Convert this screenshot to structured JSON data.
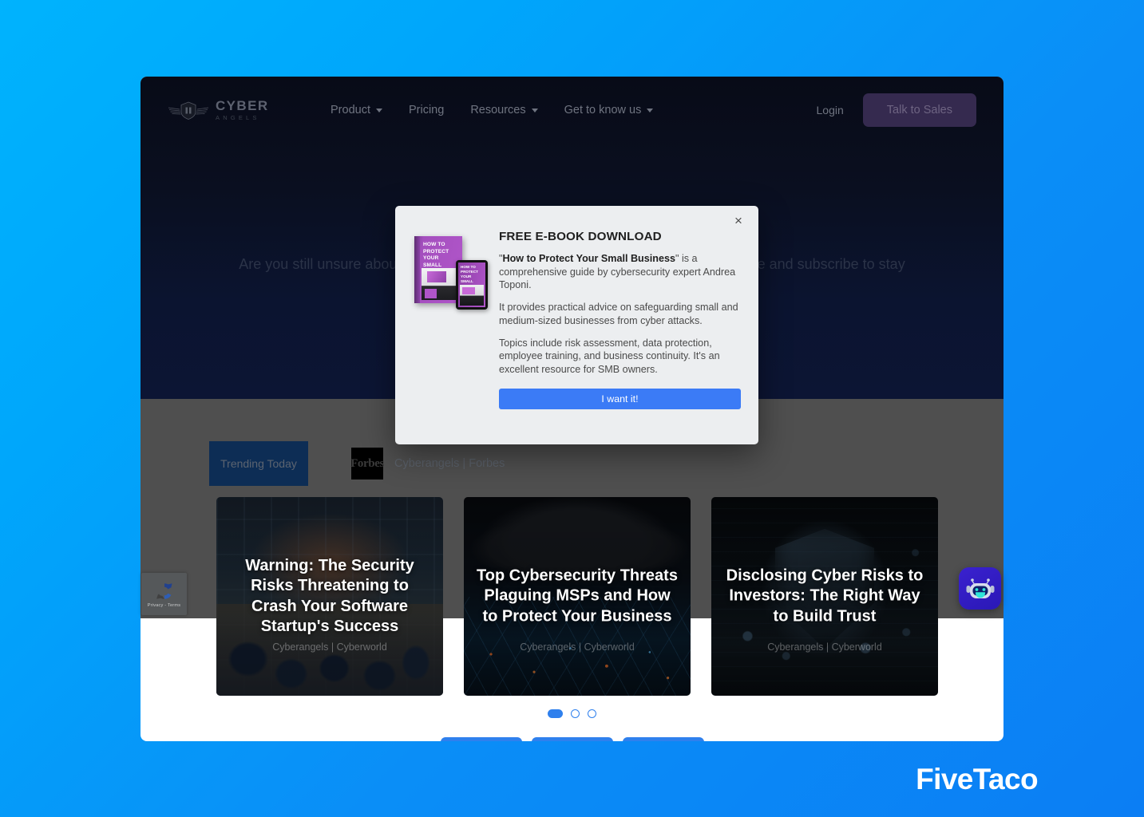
{
  "background": {
    "from": "#00b3fd",
    "to": "#0b7ef4"
  },
  "navbar": {
    "brand_name": "CYBER",
    "brand_sub": "ANGELS",
    "links": [
      {
        "label": "Product",
        "has_caret": true
      },
      {
        "label": "Pricing",
        "has_caret": false
      },
      {
        "label": "Resources",
        "has_caret": true
      },
      {
        "label": "Get to know us",
        "has_caret": true
      }
    ],
    "login_label": "Login",
    "cta_label": "Talk to Sales"
  },
  "hero": {
    "paragraph": "Are you still unsure about our services? Explore our resources below to learn more and subscribe to stay"
  },
  "trending": {
    "tab_label": "Trending Today",
    "source_logo": "Forbes",
    "source_label": "Cyberangels | Forbes",
    "cards": [
      {
        "title": "Warning: The Security Risks Threatening to Crash Your Software Startup's Success",
        "credit": "Cyberangels | Cyberworld",
        "art": "office-workspace"
      },
      {
        "title": "Top Cybersecurity Threats Plaguing MSPs and How to Protect Your Business",
        "credit": "Cyberangels | Cyberworld",
        "art": "storm-network"
      },
      {
        "title": "Disclosing Cyber Risks to Investors: The Right Way to Build Trust",
        "credit": "Cyberangels | Cyberworld",
        "art": "cracked-shield"
      }
    ],
    "dots": [
      {
        "active": true
      },
      {
        "active": false
      },
      {
        "active": false
      }
    ],
    "accent_color": "#2f80ed"
  },
  "bottom_buttons": [
    {
      "label": ""
    },
    {
      "label": ""
    },
    {
      "label": ""
    }
  ],
  "recaptcha": {
    "label": "Privacy - Terms"
  },
  "chat_widget": {
    "name": "chat-bot"
  },
  "modal": {
    "close_label": "×",
    "heading": "FREE E-BOOK DOWNLOAD",
    "paragraph1_prefix": "\"",
    "paragraph1_bold": "How to Protect Your Small Business",
    "paragraph1_suffix": "\" is a comprehensive guide by cybersecurity expert Andrea Toponi.",
    "paragraph2": "It provides practical advice on safeguarding small and medium-sized businesses from cyber attacks.",
    "paragraph3": "Topics include risk assessment, data protection, employee training, and business continuity. It's an excellent resource for SMB owners.",
    "cta_label": "I want it!",
    "cta_color": "#3b7bf6",
    "ebook": {
      "cover_title": "HOW TO PROTECT YOUR SMALL BUSINESS",
      "tablet_title": "HOW TO PROTECT YOUR SMALL BUSINESS"
    }
  },
  "watermark": {
    "text": "FiveTaco"
  }
}
